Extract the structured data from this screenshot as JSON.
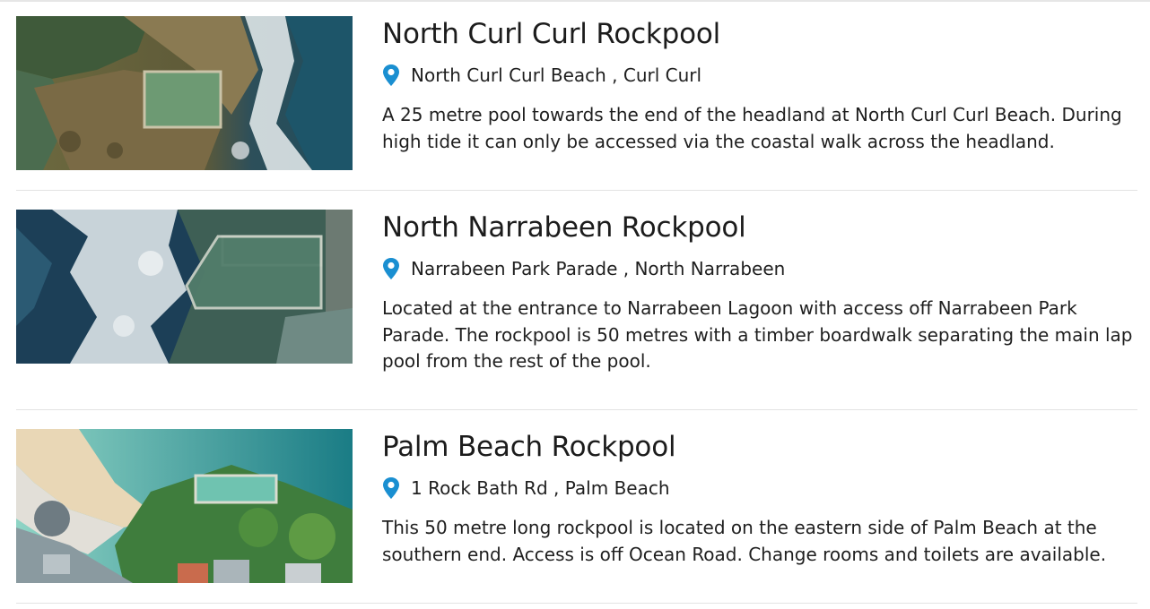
{
  "colors": {
    "accent": "#1a8fd1",
    "text": "#1f1f1f",
    "divider": "#e3e3e3"
  },
  "listings": [
    {
      "title": "North Curl Curl Rockpool",
      "location": "North Curl Curl Beach , Curl Curl",
      "description": "A 25 metre pool towards the end of the headland at North Curl Curl Beach. During high tide it can only be accessed via the coastal walk across the headland."
    },
    {
      "title": "North Narrabeen Rockpool",
      "location": "Narrabeen Park Parade , North Narrabeen",
      "description": "Located at the entrance to Narrabeen Lagoon with access off Narrabeen Park Parade. The rockpool is 50 metres with a timber boardwalk separating the main lap pool from the rest of the pool."
    },
    {
      "title": "Palm Beach Rockpool",
      "location": "1 Rock Bath Rd , Palm Beach",
      "description": "This 50 metre long rockpool is located on the eastern side of Palm Beach at the southern end. Access is off Ocean Road. Change rooms and toilets are available."
    }
  ]
}
